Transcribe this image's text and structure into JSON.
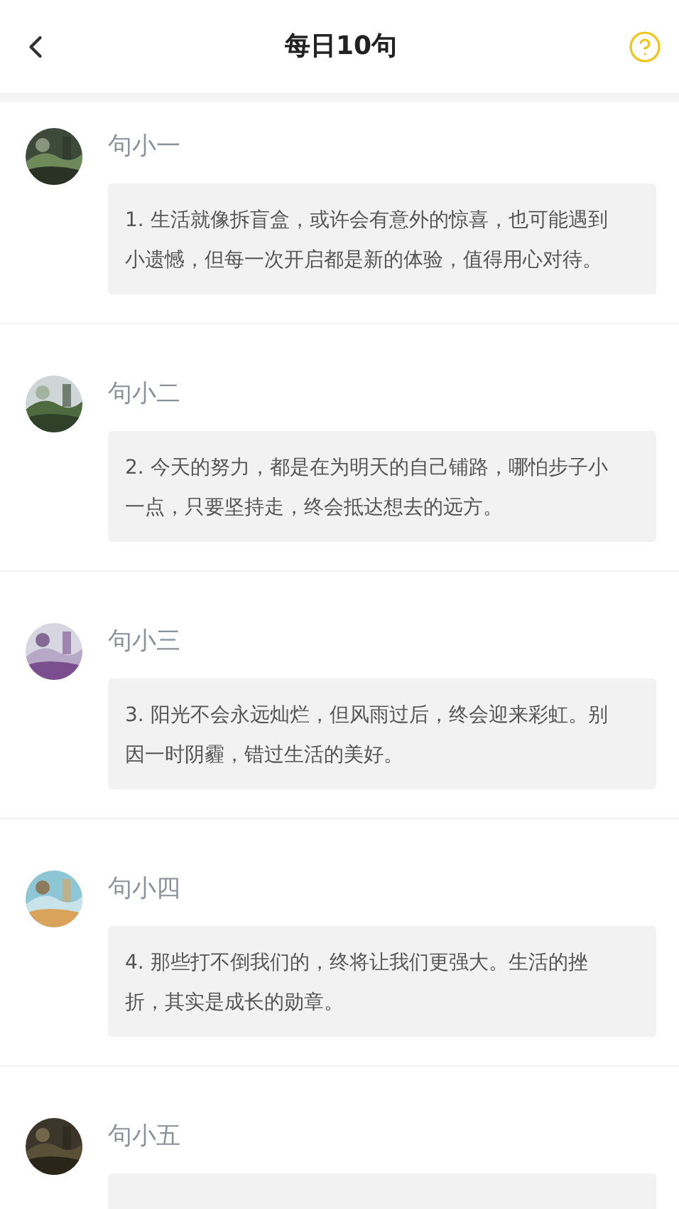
{
  "header": {
    "title": "每日10句"
  },
  "items": [
    {
      "name": "句小一",
      "text": "1. 生活就像拆盲盒，或许会有意外的惊喜，也可能遇到小遗憾，但每一次开启都是新的体验，值得用心对待。"
    },
    {
      "name": "句小二",
      "text": "2. 今天的努力，都是在为明天的自己铺路，哪怕步子小一点，只要坚持走，终会抵达想去的远方。"
    },
    {
      "name": "句小三",
      "text": "3. 阳光不会永远灿烂，但风雨过后，终会迎来彩虹。别因一时阴霾，错过生活的美好。"
    },
    {
      "name": "句小四",
      "text": "4. 那些打不倒我们的，终将让我们更强大。生活的挫折，其实是成长的勋章。"
    },
    {
      "name": "句小五"
    }
  ]
}
